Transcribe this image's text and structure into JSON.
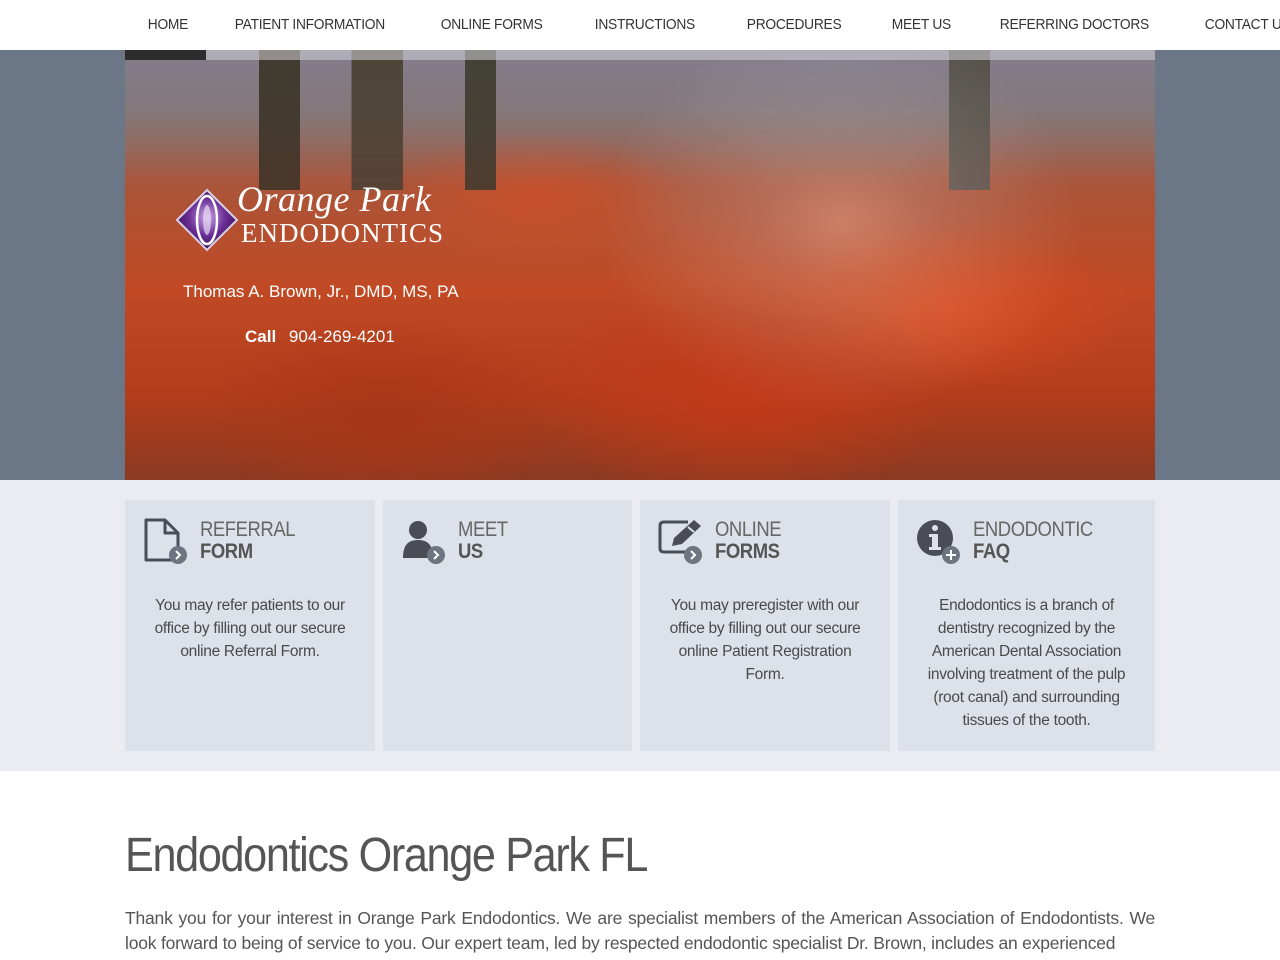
{
  "nav": {
    "items": [
      {
        "label": "HOME"
      },
      {
        "label": "PATIENT INFORMATION"
      },
      {
        "label": "ONLINE FORMS"
      },
      {
        "label": "INSTRUCTIONS"
      },
      {
        "label": "PROCEDURES"
      },
      {
        "label": "MEET US"
      },
      {
        "label": "REFERRING DOCTORS"
      },
      {
        "label": "CONTACT US"
      }
    ]
  },
  "hero": {
    "logo_script": "Orange Park",
    "logo_caps": "ENDODONTICS",
    "doctor": "Thomas A. Brown, Jr., DMD, MS, PA",
    "call_label": "Call",
    "phone": "904-269-4201"
  },
  "cards": [
    {
      "title_1": "REFERRAL",
      "title_2": "FORM",
      "icon": "document-icon",
      "text": "You may refer patients to our office by filling out our secure online Referral Form."
    },
    {
      "title_1": "MEET",
      "title_2": "US",
      "icon": "person-icon",
      "text": ""
    },
    {
      "title_1": "ONLINE",
      "title_2": "FORMS",
      "icon": "edit-form-icon",
      "text": "You may preregister with our office by filling out our secure online Patient Registration Form."
    },
    {
      "title_1": "ENDODONTIC",
      "title_2": "FAQ",
      "icon": "info-icon",
      "text": "Endodontics is a branch of dentistry recognized by the American Dental Association involving treatment of the pulp (root canal) and surrounding tissues of the tooth."
    }
  ],
  "main": {
    "title": "Endodontics Orange Park FL",
    "intro": "Thank you for your interest in Orange Park Endodontics. We are specialist members of the American Association of Endodontists. We look forward to being of service to you. Our expert team, led by respected endodontic specialist Dr. Brown, includes an experienced"
  },
  "colors": {
    "hero_band": "#6b7786",
    "features_band": "#eaecf1",
    "card_bg": "#dce1ea",
    "icon_dark": "#4a4d55",
    "icon_badge": "#6e7580"
  }
}
